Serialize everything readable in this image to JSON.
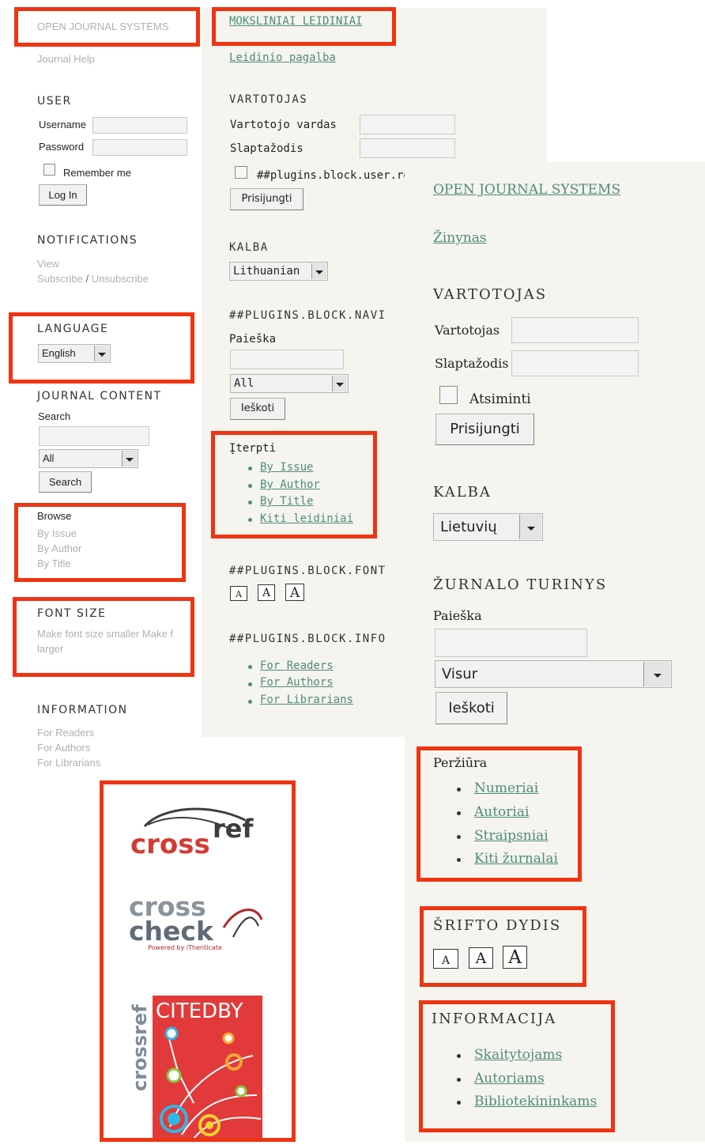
{
  "panel_en": {
    "site_title": "OPEN JOURNAL SYSTEMS",
    "journal_help": "Journal Help",
    "user": {
      "heading": "USER",
      "username_label": "Username",
      "password_label": "Password",
      "remember_label": "Remember me",
      "login_button": "Log In"
    },
    "notifications": {
      "heading": "NOTIFICATIONS",
      "view": "View",
      "subscribe": "Subscribe",
      "separator": "/",
      "unsubscribe": "Unsubscribe"
    },
    "language": {
      "heading": "LANGUAGE",
      "selected": "English"
    },
    "journal_content": {
      "heading": "JOURNAL CONTENT",
      "search_label": "Search",
      "scope_selected": "All",
      "search_button": "Search"
    },
    "browse": {
      "heading": "Browse",
      "items": [
        "By Issue",
        "By Author",
        "By Title"
      ]
    },
    "font_size": {
      "heading": "FONT SIZE",
      "line1": "Make font size smaller Make f",
      "line2": "larger"
    },
    "information": {
      "heading": "INFORMATION",
      "items": [
        "For Readers",
        "For Authors",
        "For Librarians"
      ]
    }
  },
  "panel_lt_mono": {
    "site_title": "MOKSLINIAI LEIDINIAI",
    "help": "Leidinio pagalba",
    "user": {
      "heading": "VARTOTOJAS",
      "username_label": "Vartotojo vardas",
      "password_label": "Slaptažodis",
      "remember_label": "##plugins.block.user.re",
      "login_button": "Prisijungti"
    },
    "language": {
      "heading": "KALBA",
      "selected": "Lithuanian"
    },
    "navigation": {
      "heading": "##PLUGINS.BLOCK.NAVI",
      "search_label": "Paieška",
      "scope_selected": "All",
      "search_button": "Ieškoti"
    },
    "browse": {
      "heading": "Įterpti",
      "items": [
        "By Issue",
        "By Author",
        "By Title",
        "Kiti leidiniai"
      ]
    },
    "font_size": {
      "heading": "##PLUGINS.BLOCK.FONT",
      "small": "A",
      "medium": "A",
      "large": "A"
    },
    "information": {
      "heading": "##PLUGINS.BLOCK.INFO",
      "items": [
        "For Readers",
        "For Authors",
        "For Librarians"
      ]
    }
  },
  "panel_lt_serif": {
    "site_title": "OPEN JOURNAL SYSTEMS",
    "help": "Žinynas",
    "user": {
      "heading": "VARTOTOJAS",
      "username_label": "Vartotojas",
      "password_label": "Slaptažodis",
      "remember_label": "Atsiminti",
      "login_button": "Prisijungti"
    },
    "language": {
      "heading": "KALBA",
      "selected": "Lietuvių"
    },
    "journal_content": {
      "heading": "ŽURNALO TURINYS",
      "search_label": "Paieška",
      "scope_selected": "Visur",
      "search_button": "Ieškoti"
    },
    "browse": {
      "heading": "Peržiūra",
      "items": [
        "Numeriai",
        "Autoriai",
        "Straipsniai",
        "Kiti žurnalai"
      ]
    },
    "font_size": {
      "heading": "ŠRIFTO DYDIS",
      "small": "A",
      "medium": "A",
      "large": "A"
    },
    "information": {
      "heading": "INFORMACIJA",
      "items": [
        "Skaitytojams",
        "Autoriams",
        "Bibliotekininkams"
      ]
    }
  },
  "logos": {
    "crossref": {
      "word1": "cross",
      "word2": "ref"
    },
    "crosscheck": {
      "word1": "cross",
      "word2": "check",
      "tagline": "Powered by iThenticate"
    },
    "citedby": {
      "vertical": "crossref",
      "label": "CITEDBY"
    }
  },
  "colors": {
    "highlight": "#ee3412",
    "link": "#4f8d78",
    "faded_link": "#a9b5aa",
    "panel_bg": "#f5f4ee",
    "crossref_red": "#d33b32",
    "crosscheck_gray": "#6f7a83",
    "citedby_red": "#e23a3a"
  }
}
